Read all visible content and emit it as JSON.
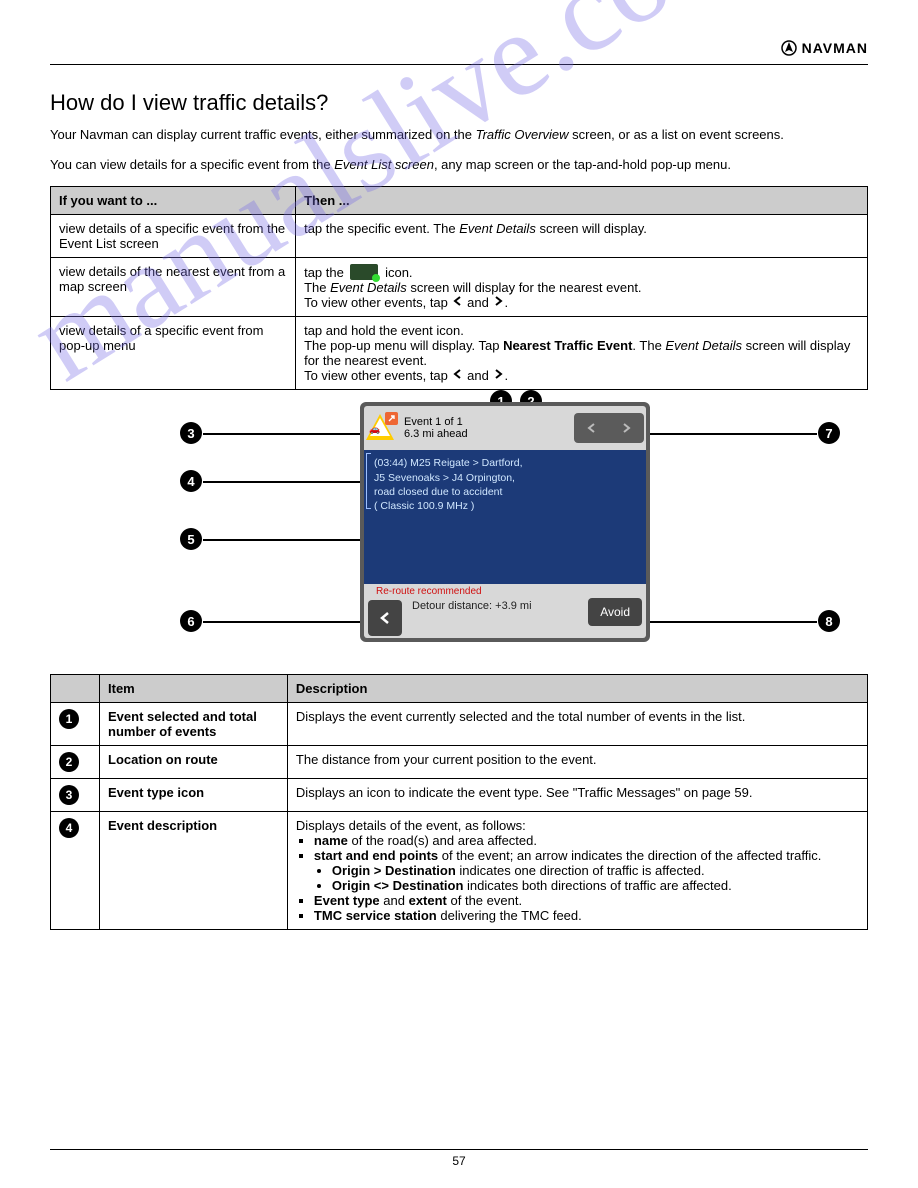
{
  "header": {
    "brand": "NAVMAN"
  },
  "section": {
    "title": "How do I view traffic details?",
    "intro1_prefix": "Your Navman can display current traffic events, either summarized on the ",
    "intro1_italic": "Traffic Overview",
    "intro1_suffix": " screen, or as a list on event screens.",
    "intro2_prefix": "You can view details for a specific event from the ",
    "intro2_italic": "Event List screen",
    "intro2_suffix": ", any map screen or the tap-and-hold pop-up menu."
  },
  "table1": {
    "head": {
      "col1": "If you want to ...",
      "col2": "Then ..."
    },
    "rows": [
      {
        "col1": "view details of a specific event from the Event List screen",
        "col2_prefix": "tap the specific event. The ",
        "col2_italic": "Event Details",
        "col2_suffix": " screen will display."
      },
      {
        "col1": "view details of the nearest event from a map screen",
        "col2_pref": "tap the ",
        "col2_mid": " icon.",
        "col2_line2_pref": "The ",
        "col2_line2_italic": "Event Details",
        "col2_line2_suffix": " screen will display for the nearest event.",
        "col2_line3_prefix": "To view other events, tap ",
        "col2_line3_mid": " and ",
        "col2_line3_b": "."
      },
      {
        "col1": "view details of a specific event from pop-up menu",
        "col2_l1": "tap and hold the event icon.",
        "col2_l2_prefix": "The pop-up menu will display. Tap ",
        "col2_l2_bold": "Nearest Traffic Event",
        "col2_l2_suffix": ". The ",
        "col2_l2_italic": "Event Details",
        "col2_l2_end": " screen will display for the nearest event.",
        "col2_l3_prefix": "To view other events, tap ",
        "col2_l3_mid": " and ",
        "col2_l3_end": "."
      }
    ]
  },
  "device": {
    "event_line": "Event 1 of 1",
    "ahead_line": "6.3 mi ahead",
    "detail_1": "(03:44) M25 Reigate > Dartford,",
    "detail_2": "J5 Sevenoaks > J4 Orpington,",
    "detail_3": "road closed due to accident",
    "detail_4": "( Classic 100.9 MHz )",
    "reroute": "Re-route recommended",
    "detour": "Detour distance: +3.9 mi",
    "avoid": "Avoid"
  },
  "table2": {
    "head": {
      "c1": "",
      "c2": "Item",
      "c3": "Description"
    },
    "rows": [
      {
        "n": "1",
        "item": "Event selected and total number of events",
        "desc": "Displays the event currently selected and the total number of events in the list."
      },
      {
        "n": "2",
        "item": "Location on route",
        "desc": "The distance from your current position to the event."
      },
      {
        "n": "3",
        "item": "Event type icon",
        "desc_prefix": "Displays an icon to indicate the event type. See \"Traffic Messages\" on page ",
        "desc_page": "59",
        "desc_suffix": "."
      },
      {
        "n": "4",
        "item": "Event description",
        "desc_intro": "Displays details of the event, as follows:",
        "b1_label": "name",
        "b1_text": " of the road(s) and area affected.",
        "b2_label": "start and end points",
        "b2_text": " of the event; an arrow indicates the direction of the affected traffic.",
        "b2_sub1_label": "Origin > Destination",
        "b2_sub1_text": " indicates one direction of traffic is affected.",
        "b2_sub2_label": "Origin <> Destination",
        "b2_sub2_text": " indicates both directions of traffic are affected.",
        "b3_label": "Event type",
        "b3_text": " and ",
        "b3_label2": "extent",
        "b3_text2": " of the event.",
        "b4_label": "TMC service station",
        "b4_text": " delivering the TMC feed."
      }
    ]
  },
  "footer": {
    "page": "57"
  },
  "glyph": {
    "prev": "◄",
    "next": "►",
    "back": "‹"
  }
}
